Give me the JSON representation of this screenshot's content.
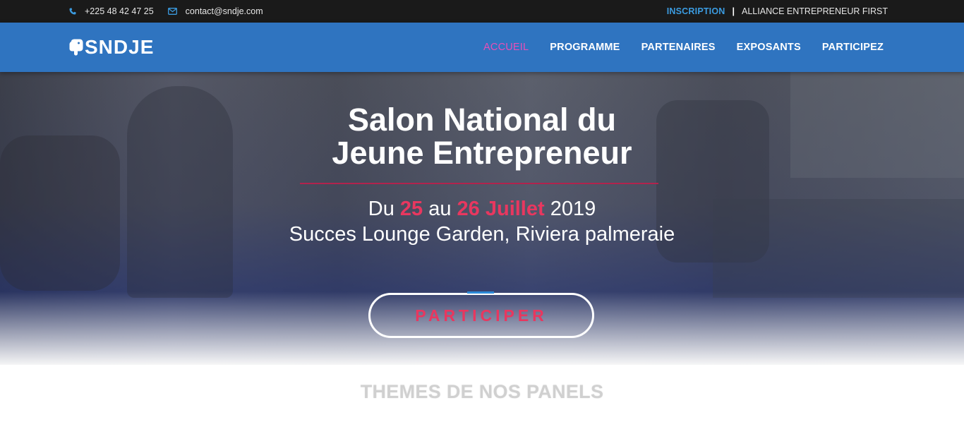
{
  "topbar": {
    "phone": "+225 48 42 47 25",
    "phone_icon": "phone-icon",
    "email": "contact@sndje.com",
    "email_icon": "envelope-icon",
    "inscription": "INSCRIPTION",
    "separator": "|",
    "alliance": "ALLIANCE ENTREPRENEUR FIRST"
  },
  "navbar": {
    "logo_text": "SNDJE",
    "logo_icon": "elephant-logo-icon",
    "items": [
      {
        "label": "ACCUEIL",
        "active": true
      },
      {
        "label": "PROGRAMME",
        "active": false
      },
      {
        "label": "PARTENAIRES",
        "active": false
      },
      {
        "label": "EXPOSANTS",
        "active": false
      },
      {
        "label": "PARTICIPEZ",
        "active": false
      }
    ]
  },
  "hero": {
    "title_line1": "Salon National du",
    "title_line2": "Jeune Entrepreneur",
    "dates": {
      "prefix": "Du ",
      "start": "25",
      "middle": " au ",
      "end": "26 Juillet",
      "year": " 2019"
    },
    "place": "Succes Lounge Garden, Riviera palmeraie",
    "cta_label": "PARTICIPER"
  },
  "section": {
    "title": "THEMES DE NOS PANELS"
  },
  "colors": {
    "navbar_bg": "#2f74c0",
    "topbar_bg": "#1a1a1a",
    "accent_pink": "#e8375f",
    "active_nav": "#e84fb7",
    "inscription_blue": "#3b9be0"
  }
}
